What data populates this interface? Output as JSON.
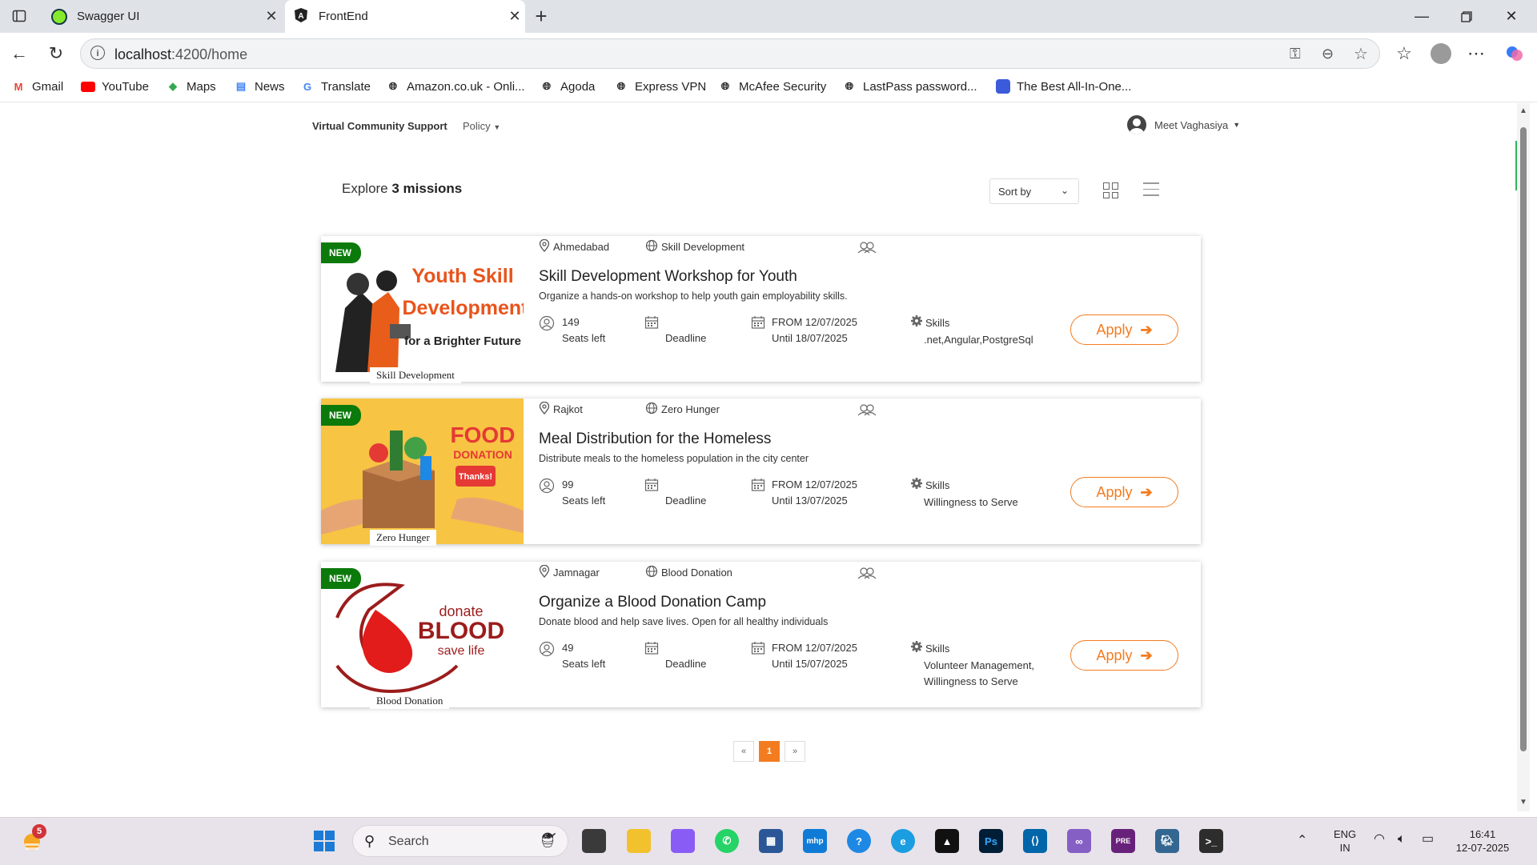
{
  "browser": {
    "tabs": [
      {
        "title": "Swagger UI",
        "icon": "swagger-icon",
        "color": "#85ea2d"
      },
      {
        "title": "FrontEnd",
        "icon": "angular-icon",
        "color": "#222222"
      }
    ],
    "url_host": "localhost",
    "url_rest": ":4200/home",
    "bookmarks": [
      {
        "label": "Gmail",
        "icon": "gmail-icon"
      },
      {
        "label": "YouTube",
        "icon": "youtube-icon"
      },
      {
        "label": "Maps",
        "icon": "maps-icon"
      },
      {
        "label": "News",
        "icon": "news-icon"
      },
      {
        "label": "Translate",
        "icon": "translate-icon"
      },
      {
        "label": "Amazon.co.uk - Onli...",
        "icon": "globe-icon"
      },
      {
        "label": "Agoda",
        "icon": "globe-icon"
      },
      {
        "label": "Express VPN",
        "icon": "globe-icon"
      },
      {
        "label": "McAfee Security",
        "icon": "globe-icon"
      },
      {
        "label": "LastPass password...",
        "icon": "globe-icon"
      },
      {
        "label": "The Best All-In-One...",
        "icon": "bookmark-app-icon"
      }
    ]
  },
  "app": {
    "brand": "Virtual Community Support",
    "policy": "Policy",
    "user": "Meet Vaghasiya",
    "explore_prefix": "Explore",
    "explore_count": "3 missions",
    "sort_label": "Sort by",
    "accent": "#f47c20"
  },
  "missions": [
    {
      "badge": "NEW",
      "city": "Ahmedabad",
      "theme": "Skill Development",
      "title": "Skill Development Workshop for Youth",
      "description": "Organize a hands-on workshop to help youth gain employability skills.",
      "seats": "149",
      "seats_label": "Seats left",
      "deadline_label": "Deadline",
      "from": "FROM 12/07/2025",
      "until": "Until 18/07/2025",
      "skills_label": "Skills",
      "skills": ".net,Angular,PostgreSql",
      "apply": "Apply",
      "image_label": "Skill Development",
      "image_text": [
        "Youth Skill",
        "Development",
        "for a Brighter Future"
      ]
    },
    {
      "badge": "NEW",
      "city": "Rajkot",
      "theme": "Zero Hunger",
      "title": "Meal Distribution for the Homeless",
      "description": "Distribute meals to the homeless population in the city center",
      "seats": "99",
      "seats_label": "Seats left",
      "deadline_label": "Deadline",
      "from": "FROM 12/07/2025",
      "until": "Until 13/07/2025",
      "skills_label": "Skills",
      "skills": "Willingness to Serve",
      "apply": "Apply",
      "image_label": "Zero Hunger",
      "image_text": [
        "FOOD",
        "DONATION",
        "Thanks!"
      ]
    },
    {
      "badge": "NEW",
      "city": "Jamnagar",
      "theme": "Blood Donation",
      "title": "Organize a Blood Donation Camp",
      "description": "Donate blood and help save lives. Open for all healthy individuals",
      "seats": "49",
      "seats_label": "Seats left",
      "deadline_label": "Deadline",
      "from": "FROM 12/07/2025",
      "until": "Until 15/07/2025",
      "skills_label": "Skills",
      "skills": "Volunteer Management,Willingness to Serve",
      "apply": "Apply",
      "image_label": "Blood Donation",
      "image_text": [
        "donate",
        "BLOOD",
        "save life"
      ]
    }
  ],
  "pagination": {
    "prev": "«",
    "current": "1",
    "next": "»"
  },
  "taskbar": {
    "weather_badge": "5",
    "search_placeholder": "Search",
    "lang_top": "ENG",
    "lang_bottom": "IN",
    "time": "16:41",
    "date": "12-07-2025",
    "ps_label": "Ps",
    "mhp_label": "mhp",
    "pre_label": "PRE"
  }
}
